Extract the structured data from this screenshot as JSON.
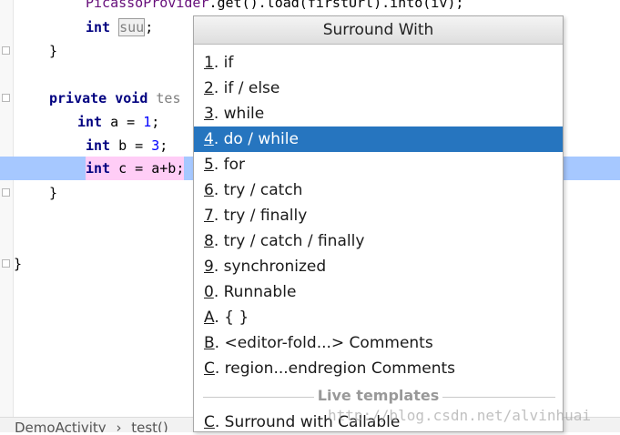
{
  "editor": {
    "line1_method": "PicassoProvider",
    "line1_rest": ".get().load(firstUrl).into(iv);",
    "line2_type": "int",
    "line2_ident": "suu",
    "line2_end": ";",
    "line3": "}",
    "line4_mod": "private void",
    "line4_name": "tes",
    "line5_type": "int",
    "line5_rest": " a = ",
    "line5_num": "1",
    "line5_end": ";",
    "line6_type": "int",
    "line6_rest": " b = ",
    "line6_num": "3",
    "line6_end": ";",
    "line7_type": "int",
    "line7_rest": " c = a+b;",
    "line8": "}",
    "line9": "}"
  },
  "breadcrumb": {
    "class": "DemoActivity",
    "separator": "›",
    "method": "test()"
  },
  "popup": {
    "title": "Surround With",
    "items": [
      {
        "mnemonic": "1",
        "label": ". if"
      },
      {
        "mnemonic": "2",
        "label": ". if / else"
      },
      {
        "mnemonic": "3",
        "label": ". while"
      },
      {
        "mnemonic": "4",
        "label": ". do / while"
      },
      {
        "mnemonic": "5",
        "label": ". for"
      },
      {
        "mnemonic": "6",
        "label": ". try / catch"
      },
      {
        "mnemonic": "7",
        "label": ". try / finally"
      },
      {
        "mnemonic": "8",
        "label": ". try / catch / finally"
      },
      {
        "mnemonic": "9",
        "label": ". synchronized"
      },
      {
        "mnemonic": "0",
        "label": ". Runnable"
      },
      {
        "mnemonic": "A",
        "label": ". { }"
      },
      {
        "mnemonic": "B",
        "label": ". <editor-fold...> Comments"
      },
      {
        "mnemonic": "C",
        "label": ". region...endregion Comments"
      }
    ],
    "selected_index": 3,
    "section_label": "Live templates",
    "template_item": {
      "mnemonic": "C",
      "label": ". Surround with Callable"
    }
  },
  "watermark": "http://blog.csdn.net/alvinhuai"
}
